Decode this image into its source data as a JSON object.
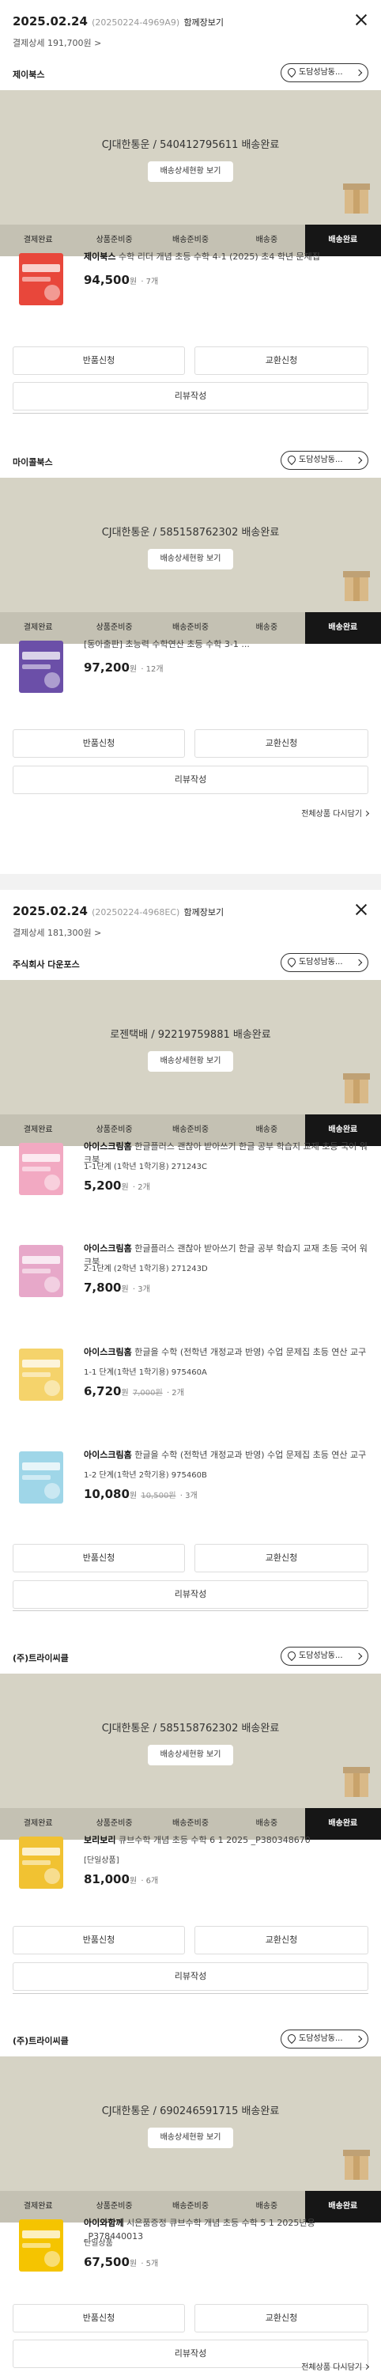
{
  "orders": [
    {
      "date": "2025.02.24",
      "order_no": "(20250224-4969A9)",
      "cart": "함께장보기",
      "summary": "결제상세 191,700원 >",
      "sections": [
        {
          "seller": "제이북스",
          "store": "도담성남동...",
          "courier": "CJ대한통운 / 540412795611 배송완료",
          "track": "배송상세현황 보기",
          "steps": [
            "결제완료",
            "상품준비중",
            "배송준비중",
            "배송중",
            "배송완료"
          ],
          "items": [
            {
              "brand": "제이북스",
              "name": "수학 리더 개념 초등 수학 4-1 (2025) 초4 학년 문제집",
              "option": "",
              "price": "94,500",
              "unit": "원",
              "old": "",
              "qty": "· 7개"
            }
          ],
          "buttons": {
            "return": "반품신청",
            "exchange": "교환신청",
            "review": "리뷰작성"
          }
        },
        {
          "seller": "마이콜북스",
          "store": "도담성남동...",
          "courier": "CJ대한통운 / 585158762302 배송완료",
          "track": "배송상세현황 보기",
          "steps": [
            "결제완료",
            "상품준비중",
            "배송준비중",
            "배송중",
            "배송완료"
          ],
          "items": [
            {
              "brand": "",
              "name": "[동아출판] 초능력 수학연산 초등 수학 3-1 ...",
              "option": "",
              "price": "97,200",
              "unit": "원",
              "old": "",
              "qty": "· 12개"
            }
          ],
          "buttons": {
            "return": "반품신청",
            "exchange": "교환신청",
            "review": "리뷰작성"
          },
          "reorder": "전체상품 다시담기"
        }
      ]
    },
    {
      "date": "2025.02.24",
      "order_no": "(20250224-4968EC)",
      "cart": "함께장보기",
      "summary": "결제상세 181,300원 >",
      "sections": [
        {
          "seller": "주식회사 다운포스",
          "store": "도담성남동...",
          "courier": "로젠택배 / 92219759881 배송완료",
          "track": "배송상세현황 보기",
          "steps": [
            "결제완료",
            "상품준비중",
            "배송준비중",
            "배송중",
            "배송완료"
          ],
          "items": [
            {
              "brand": "아이스크림홈",
              "name": "한글플러스 괜찮아 받아쓰기 한글 공부 학습지 교재 초등 국어 워크북",
              "option": "1-1단계 (1학년 1학기용) 271243C",
              "price": "5,200",
              "unit": "원",
              "old": "",
              "qty": "· 2개"
            },
            {
              "brand": "아이스크림홈",
              "name": "한글플러스 괜찮아 받아쓰기 한글 공부 학습지 교재 초등 국어 워크북",
              "option": "2-1단계 (2학년 1학기용) 271243D",
              "price": "7,800",
              "unit": "원",
              "old": "",
              "qty": "· 3개"
            },
            {
              "brand": "아이스크림홈",
              "name": "한글을 수학 (전학년 개정교과 반영) 수업 문제집 초등 연산 교구",
              "option": "1-1 단계(1학년 1학기용) 975460A",
              "price": "6,720",
              "unit": "원",
              "old": "7,000원",
              "qty": "· 2개"
            },
            {
              "brand": "아이스크림홈",
              "name": "한글을 수학 (전학년 개정교과 반영) 수업 문제집 초등 연산 교구",
              "option": "1-2 단계(1학년 2학기용) 975460B",
              "price": "10,080",
              "unit": "원",
              "old": "10,500원",
              "qty": "· 3개"
            }
          ],
          "buttons": {
            "return": "반품신청",
            "exchange": "교환신청",
            "review": "리뷰작성"
          }
        },
        {
          "seller": "(주)트라이씨클",
          "store": "도담성남동...",
          "courier": "CJ대한통운 / 585158762302 배송완료",
          "track": "배송상세현황 보기",
          "steps": [
            "결제완료",
            "상품준비중",
            "배송준비중",
            "배송중",
            "배송완료"
          ],
          "items": [
            {
              "brand": "보리보리",
              "name": "큐브수학 개념 초등 수학 6 1 2025 _P380348670",
              "option": "[단일상품]",
              "price": "81,000",
              "unit": "원",
              "old": "",
              "qty": "· 6개"
            }
          ],
          "buttons": {
            "return": "반품신청",
            "exchange": "교환신청",
            "review": "리뷰작성"
          }
        },
        {
          "seller": "(주)트라이씨클",
          "store": "도담성남동...",
          "courier": "CJ대한통운 / 690246591715 배송완료",
          "track": "배송상세현황 보기",
          "steps": [
            "결제완료",
            "상품준비중",
            "배송준비중",
            "배송중",
            "배송완료"
          ],
          "items": [
            {
              "brand": "아이와함께",
              "name": "시은품증정 큐브수학 개념 초등 수학 5 1 2025년용 _P378440013",
              "option": "단일상품",
              "price": "67,500",
              "unit": "원",
              "old": "",
              "qty": "· 5개"
            }
          ],
          "buttons": {
            "return": "반품신청",
            "exchange": "교환신청",
            "review": "리뷰작성"
          },
          "reorder": "전체상품 다시담기"
        }
      ]
    }
  ],
  "thumb_colors": [
    "#e8473b",
    "#6b4fa8",
    "#f2a9c2",
    "#e7a8c9",
    "#f5d36b",
    "#9fd6e8",
    "#f1c232",
    "#f5c400"
  ],
  "icons": {
    "close": "close-icon",
    "store": "location-pin-icon",
    "box": "parcel-box-icon"
  }
}
